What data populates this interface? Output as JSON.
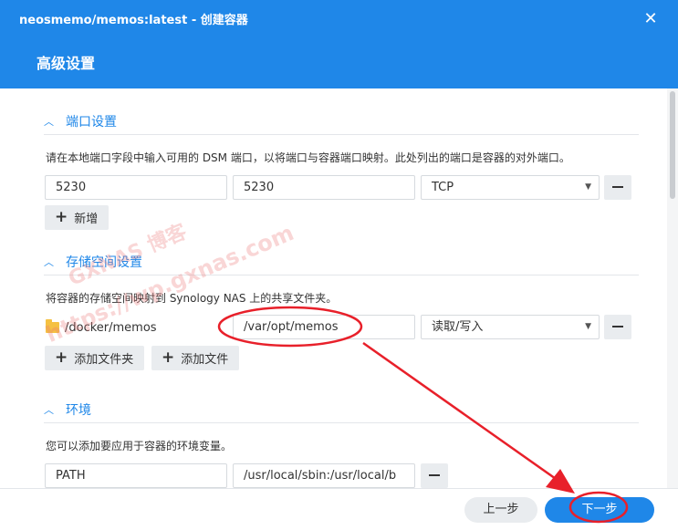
{
  "window": {
    "title": "neosmemo/memos:latest - 创建容器"
  },
  "page": {
    "title": "高级设置"
  },
  "ports": {
    "heading": "端口设置",
    "description": "请在本地端口字段中输入可用的 DSM 端口，以将端口与容器端口映射。此处列出的端口是容器的对外端口。",
    "row": {
      "local_port": "5230",
      "container_port": "5230",
      "protocol": "TCP"
    },
    "add_label": "新增"
  },
  "storage": {
    "heading": "存储空间设置",
    "description": "将容器的存储空间映射到 Synology NAS 上的共享文件夹。",
    "row": {
      "folder": "/docker/memos",
      "mount_path": "/var/opt/memos",
      "permission": "读取/写入"
    },
    "add_folder_label": "添加文件夹",
    "add_file_label": "添加文件"
  },
  "environment": {
    "heading": "环境",
    "description": "您可以添加要应用于容器的环境变量。",
    "row": {
      "name": "PATH",
      "value": "/usr/local/sbin:/usr/local/b"
    }
  },
  "footer": {
    "prev_label": "上一步",
    "next_label": "下一步"
  },
  "watermark": {
    "line1": "GXNAS 博客",
    "line2": "https://wp.gxnas.com"
  },
  "colors": {
    "brand": "#1f87e8",
    "annotation": "#e8202a",
    "folder": "#f5c142"
  },
  "icons": {
    "close": "close-icon",
    "section_toggle": "chevron-up-icon",
    "select": "caret-down-icon",
    "add": "plus-icon",
    "remove": "minus-icon",
    "folder": "folder-icon"
  }
}
